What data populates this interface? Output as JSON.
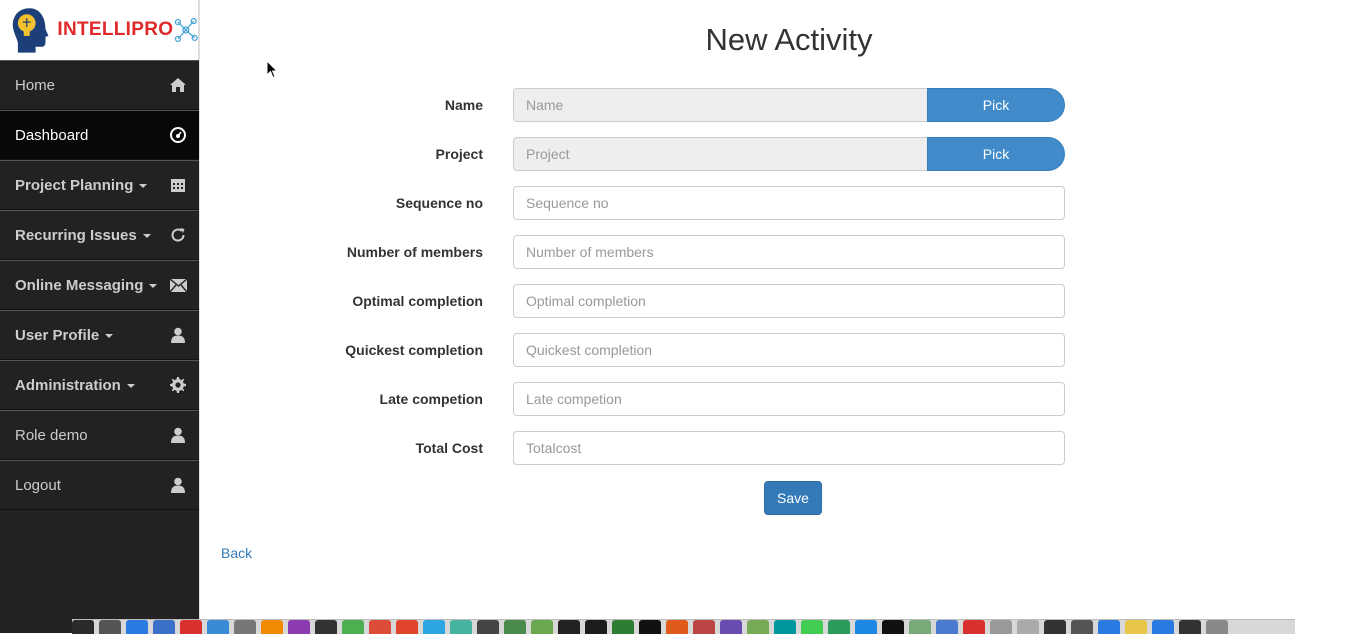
{
  "brand": {
    "name": "INTELLIPRO"
  },
  "sidebar": {
    "items": [
      {
        "label": "Home",
        "icon": "home-icon",
        "dropdown": false,
        "bold": false,
        "active": false
      },
      {
        "label": "Dashboard",
        "icon": "dashboard-icon",
        "dropdown": false,
        "bold": false,
        "active": true
      },
      {
        "label": "Project Planning",
        "icon": "calendar-icon",
        "dropdown": true,
        "bold": true,
        "active": false
      },
      {
        "label": "Recurring Issues",
        "icon": "refresh-icon",
        "dropdown": true,
        "bold": true,
        "active": false
      },
      {
        "label": "Online Messaging",
        "icon": "envelope-icon",
        "dropdown": true,
        "bold": true,
        "active": false
      },
      {
        "label": "User Profile",
        "icon": "user-icon",
        "dropdown": true,
        "bold": true,
        "active": false
      },
      {
        "label": "Administration",
        "icon": "gear-icon",
        "dropdown": true,
        "bold": true,
        "active": false
      },
      {
        "label": "Role demo",
        "icon": "user-icon",
        "dropdown": false,
        "bold": false,
        "active": false
      },
      {
        "label": "Logout",
        "icon": "user-icon",
        "dropdown": false,
        "bold": false,
        "active": false
      }
    ]
  },
  "page": {
    "title": "New Activity"
  },
  "form": {
    "name": {
      "label": "Name",
      "placeholder": "Name",
      "value": "",
      "pick_label": "Pick"
    },
    "project": {
      "label": "Project",
      "placeholder": "Project",
      "value": "",
      "pick_label": "Pick"
    },
    "sequence_no": {
      "label": "Sequence no",
      "placeholder": "Sequence no",
      "value": ""
    },
    "number_of_members": {
      "label": "Number of members",
      "placeholder": "Number of members",
      "value": ""
    },
    "optimal_completion": {
      "label": "Optimal completion",
      "placeholder": "Optimal completion",
      "value": ""
    },
    "quickest_completion": {
      "label": "Quickest completion",
      "placeholder": "Quickest completion",
      "value": ""
    },
    "late_completion": {
      "label": "Late competion",
      "placeholder": "Late competion",
      "value": ""
    },
    "total_cost": {
      "label": "Total Cost",
      "placeholder": "Totalcost",
      "value": ""
    },
    "save_label": "Save"
  },
  "back_label": "Back",
  "colors": {
    "primary": "#337ab7",
    "sidebar_bg": "#222222",
    "brand_red": "#e02a2a"
  },
  "taskbar": {
    "icons": [
      "#2b2b2b",
      "#555",
      "#2a7ae2",
      "#3c6fc8",
      "#d93030",
      "#3a8ad8",
      "#777",
      "#f08a00",
      "#8d3bb0",
      "#333",
      "#4caf50",
      "#dd4b39",
      "#e0452b",
      "#2ca5e0",
      "#45b39d",
      "#444",
      "#4a8a4a",
      "#6aa84f",
      "#222",
      "#1c1c1c",
      "#2f7d32",
      "#111",
      "#e05a1c",
      "#b44",
      "#6a4cb0",
      "#7a5",
      "#00979d",
      "#41cd52",
      "#2a9d5c",
      "#1e88e5",
      "#111",
      "#7a7",
      "#4a7bd0",
      "#d93030",
      "#999",
      "#aaa",
      "#333",
      "#555",
      "#2a7ae2",
      "#e8c64a",
      "#2a7ae2",
      "#333",
      "#888"
    ]
  }
}
